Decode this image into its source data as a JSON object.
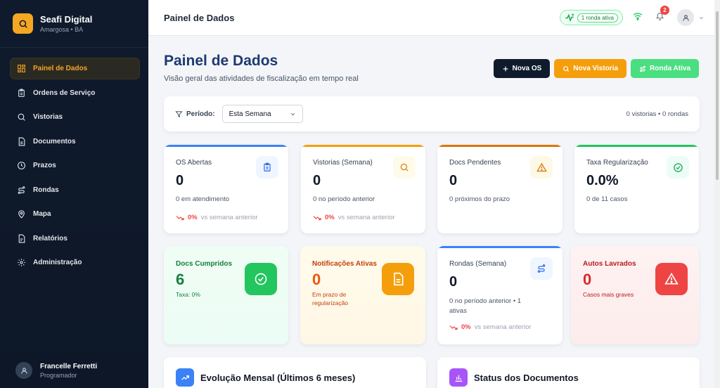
{
  "brand": {
    "name": "Seafi Digital",
    "location": "Amargosa • BA"
  },
  "sidebar": {
    "items": [
      {
        "label": "Painel de Dados",
        "icon": "dashboard-icon",
        "active": true
      },
      {
        "label": "Ordens de Serviço",
        "icon": "clipboard-icon"
      },
      {
        "label": "Vistorias",
        "icon": "search-icon"
      },
      {
        "label": "Documentos",
        "icon": "document-icon"
      },
      {
        "label": "Prazos",
        "icon": "clock-icon"
      },
      {
        "label": "Rondas",
        "icon": "route-icon"
      },
      {
        "label": "Mapa",
        "icon": "map-pin-icon"
      },
      {
        "label": "Relatórios",
        "icon": "report-icon"
      },
      {
        "label": "Administração",
        "icon": "gear-icon"
      }
    ]
  },
  "user": {
    "name": "Francelle Ferretti",
    "role": "Programador"
  },
  "topbar": {
    "title": "Painel de Dados",
    "ronda_badge": "1 ronda ativa",
    "notification_count": "2"
  },
  "header": {
    "title": "Painel de Dados",
    "subtitle": "Visão geral das atividades de fiscalização em tempo real",
    "actions": {
      "nova_os": "Nova OS",
      "nova_vistoria": "Nova Vistoria",
      "ronda_ativa": "Ronda Ativa"
    }
  },
  "filter": {
    "label": "Período:",
    "value": "Esta Semana",
    "summary": "0 vistorias • 0 rondas"
  },
  "stats": {
    "os_abertas": {
      "label": "OS Abertas",
      "value": "0",
      "desc": "0 em atendimento",
      "pct": "0%",
      "trend": "vs semana anterior"
    },
    "vistorias": {
      "label": "Vistorias (Semana)",
      "value": "0",
      "desc": "0 no período anterior",
      "pct": "0%",
      "trend": "vs semana anterior"
    },
    "docs_pendentes": {
      "label": "Docs Pendentes",
      "value": "0",
      "desc": "0 próximos do prazo"
    },
    "taxa": {
      "label": "Taxa Regularização",
      "value": "0.0%",
      "desc": "0 de 11 casos"
    },
    "docs_cumpridos": {
      "label": "Docs Cumpridos",
      "value": "6",
      "desc": "Taxa: 0%"
    },
    "notificacoes": {
      "label": "Notificações Ativas",
      "value": "0",
      "desc": "Em prazo de regularização"
    },
    "rondas": {
      "label": "Rondas (Semana)",
      "value": "0",
      "desc": "0 no período anterior • 1 ativas",
      "pct": "0%",
      "trend": "vs semana anterior"
    },
    "autos": {
      "label": "Autos Lavrados",
      "value": "0",
      "desc": "Casos mais graves"
    }
  },
  "panels": {
    "evolucao": "Evolução Mensal (Últimos 6 meses)",
    "status": "Status dos Documentos"
  },
  "colors": {
    "accent": "#f5a623",
    "navy": "#1e3a6e",
    "sidebar": "#0f1b2d",
    "green": "#22c55e",
    "red": "#ef4444",
    "blue": "#3b82f6"
  }
}
